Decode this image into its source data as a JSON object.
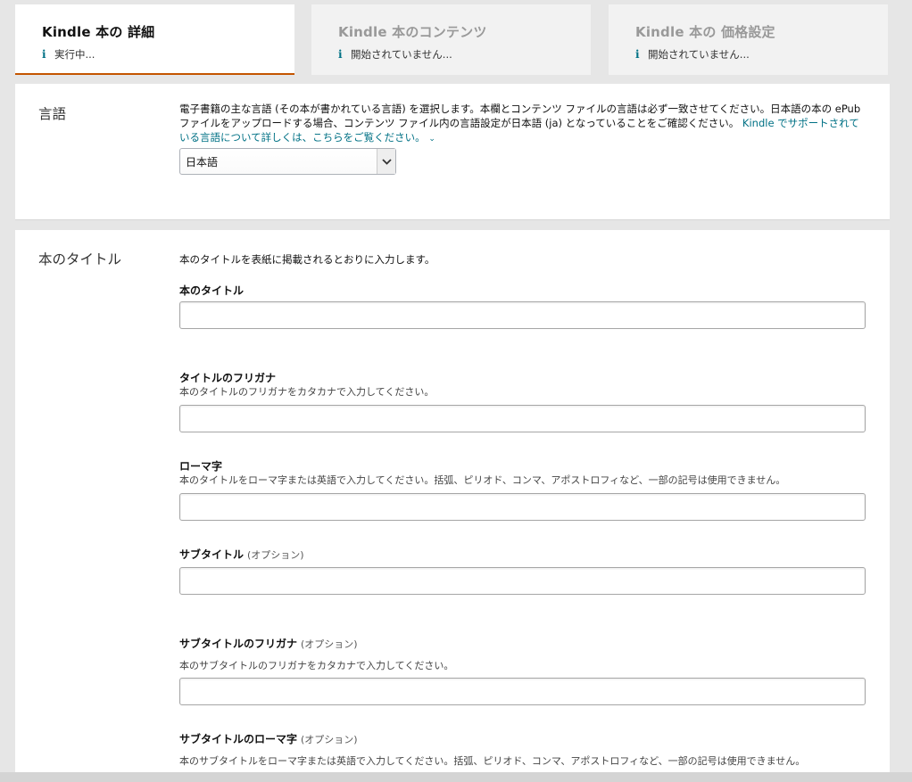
{
  "tabs": [
    {
      "title": "Kindle 本の 詳細",
      "status": "実行中..."
    },
    {
      "title": "Kindle 本のコンテンツ",
      "status": "開始されていません..."
    },
    {
      "title": "Kindle 本の 価格設定",
      "status": "開始されていません..."
    }
  ],
  "language": {
    "heading": "言語",
    "description": "電子書籍の主な言語 (その本が書かれている言語) を選択します。本欄とコンテンツ ファイルの言語は必ず一致させてください。日本語の本の ePub ファイルをアップロードする場合、コンテンツ ファイル内の言語設定が日本語 (ja) となっていることをご確認ください。",
    "link": "Kindle でサポートされている言語について詳しくは、こちらをご覧ください。",
    "selected": "日本語"
  },
  "title_section": {
    "heading": "本のタイトル",
    "description": "本のタイトルを表紙に掲載されるとおりに入力します。",
    "book_title_label": "本のタイトル",
    "furigana_label": "タイトルのフリガナ",
    "furigana_help": "本のタイトルのフリガナをカタカナで入力してください。",
    "romaji_label": "ローマ字",
    "romaji_help": "本のタイトルをローマ字または英語で入力してください。括弧、ピリオド、コンマ、アポストロフィなど、一部の記号は使用できません。",
    "subtitle_label": "サブタイトル",
    "optional": "(オプション)",
    "subtitle_furigana_label": "サブタイトルのフリガナ",
    "subtitle_furigana_help": "本のサブタイトルのフリガナをカタカナで入力してください。",
    "subtitle_romaji_label": "サブタイトルのローマ字",
    "subtitle_romaji_help": "本のサブタイトルをローマ字または英語で入力してください。括弧、ピリオド、コンマ、アポストロフィなど、一部の記号は使用できません。"
  },
  "icons": {
    "info": "info-icon",
    "chevron": "chevron-down-icon"
  },
  "colors": {
    "accent": "#c45500",
    "link": "#007185"
  }
}
